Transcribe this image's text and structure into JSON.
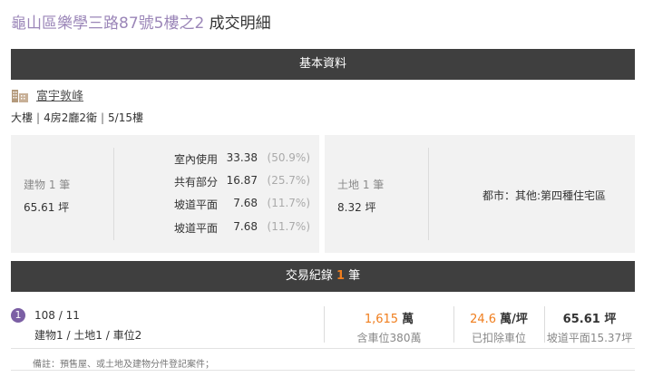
{
  "header": {
    "address": "龜山區樂學三路87號5樓之2",
    "suffix": "成交明細"
  },
  "basic_section": {
    "title": "基本資料"
  },
  "community": {
    "name": "富宇敦峰",
    "icon": "building-icon"
  },
  "specs": {
    "type": "大樓",
    "layout": "4房2廳2衛",
    "floor": "5/15樓",
    "separator": "|"
  },
  "building": {
    "label": "建物 1 筆",
    "area": "65.61 坪",
    "parts": [
      {
        "name": "室內使用",
        "value": "33.38",
        "pct": "(50.9%)"
      },
      {
        "name": "共有部分",
        "value": "16.87",
        "pct": "(25.7%)"
      },
      {
        "name": "坡道平面",
        "value": "7.68",
        "pct": "(11.7%)"
      },
      {
        "name": "坡道平面",
        "value": "7.68",
        "pct": "(11.7%)"
      }
    ]
  },
  "land": {
    "label": "土地 1 筆",
    "area": "8.32 坪",
    "zoning": "都市：其他:第四種住宅區"
  },
  "transactions": {
    "title_prefix": "交易紀錄",
    "count": "1",
    "title_suffix": "筆",
    "records": [
      {
        "index": "1",
        "date": "108 / 11",
        "detail": "建物1 / 土地1 / 車位2",
        "price_num": "1,615",
        "price_unit": "萬",
        "price_sub": "含車位380萬",
        "unit_price_num": "24.6",
        "unit_price_unit": "萬/坪",
        "unit_price_sub": "已扣除車位",
        "area_main": "65.61 坪",
        "area_sub": "坡道平面15.37坪"
      }
    ],
    "note": "備註：預售屋、或土地及建物分件登記案件；"
  }
}
